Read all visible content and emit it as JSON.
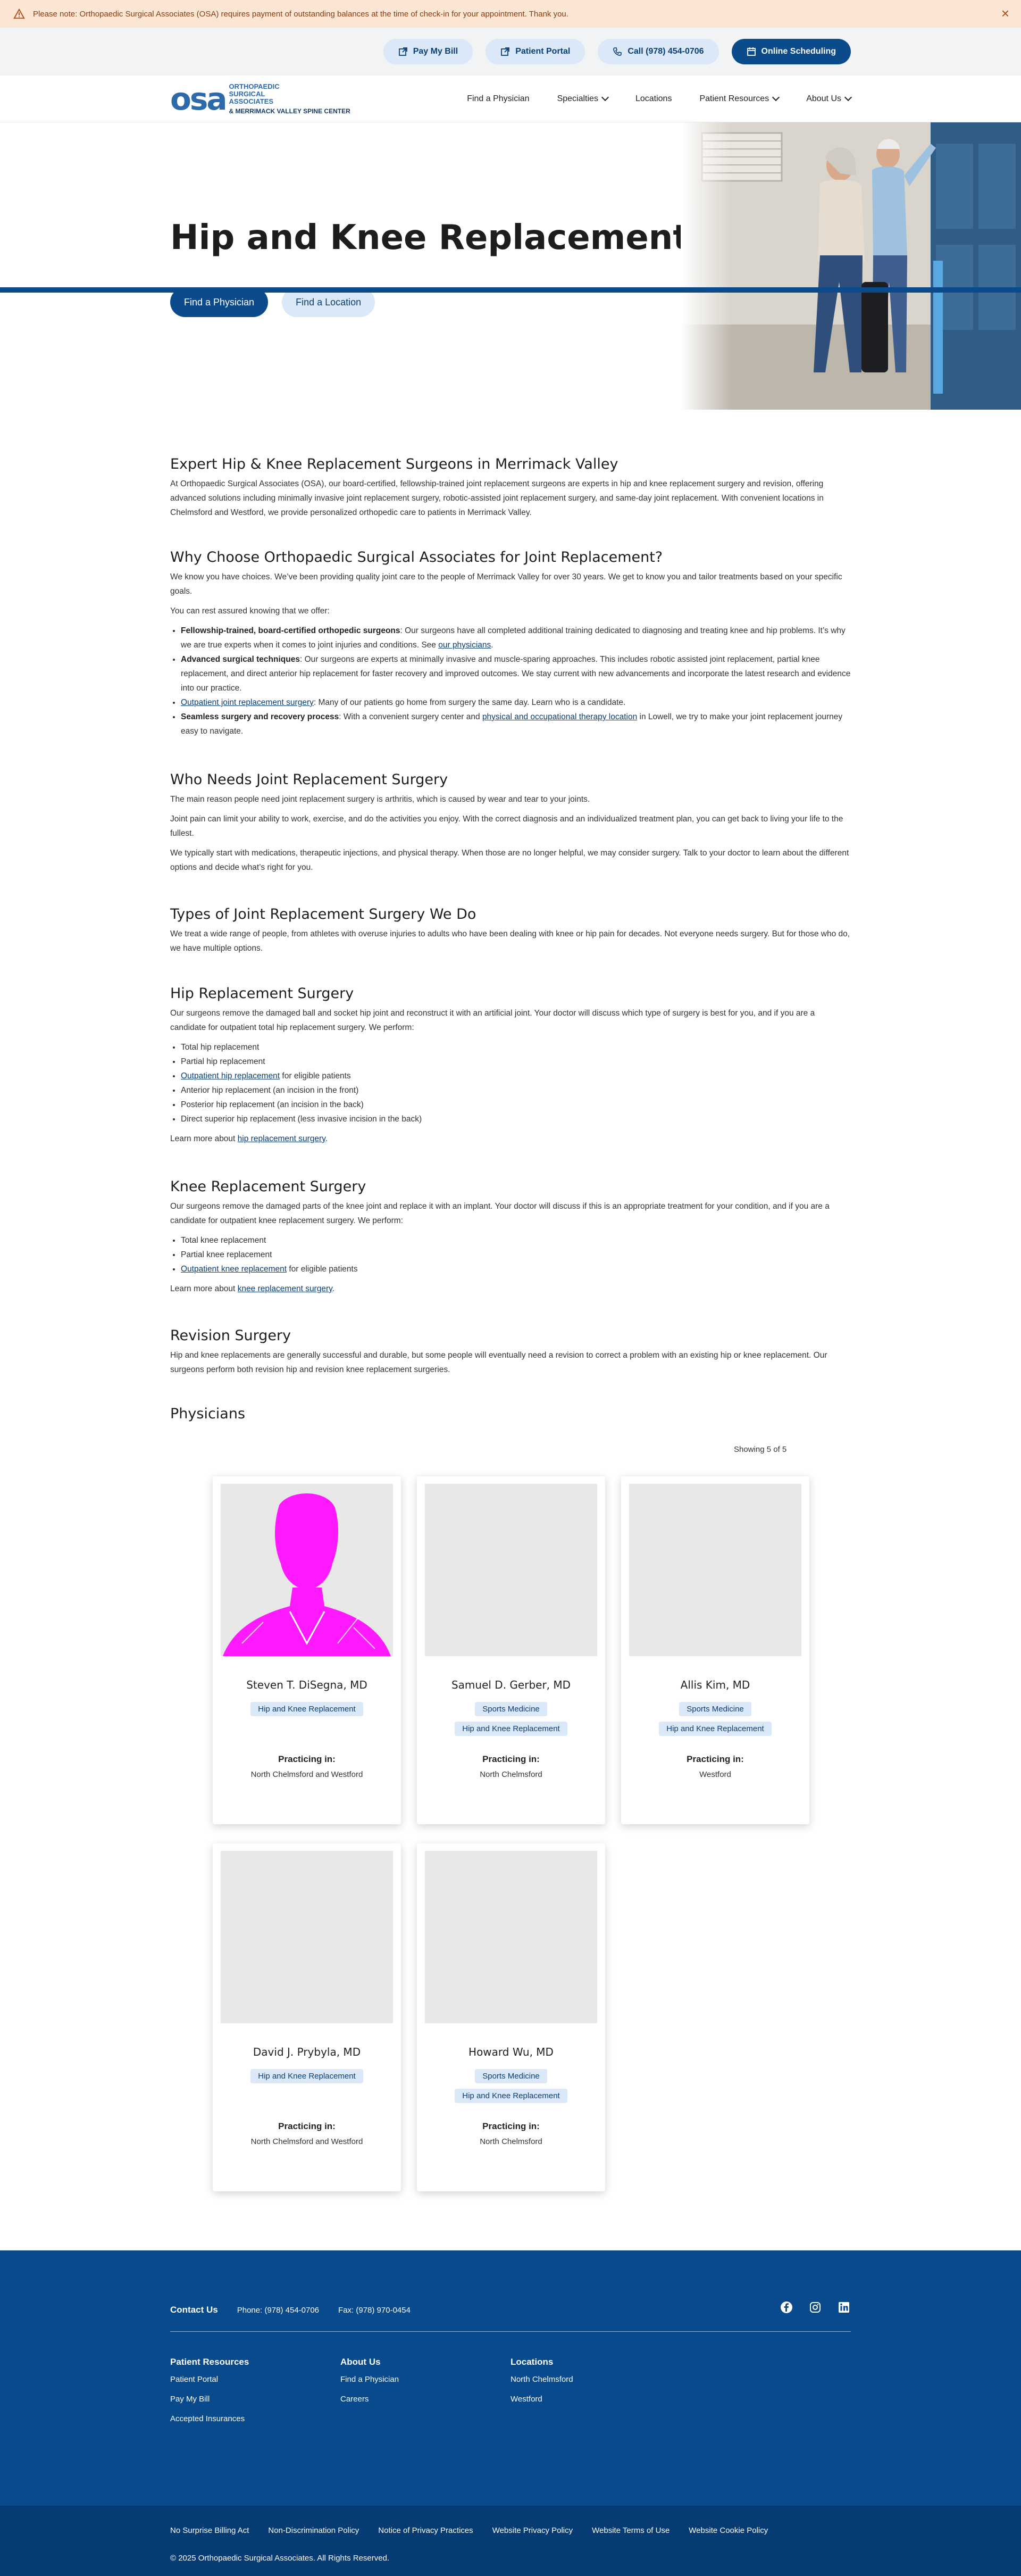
{
  "alert": {
    "text": "Please note: Orthopaedic Surgical Associates (OSA) requires payment of outstanding balances at the time of check-in for your appointment. Thank you.",
    "icon": "warning-icon",
    "close_icon": "close-icon"
  },
  "utility": {
    "pay_bill": "Pay My Bill",
    "patient_portal": "Patient Portal",
    "call": "Call (978) 454-0706",
    "online_scheduling": "Online Scheduling"
  },
  "logo": {
    "mark": "osa",
    "line1": "ORTHOPAEDIC",
    "line2": "SURGICAL",
    "line3": "ASSOCIATES",
    "line4": "& MERRIMACK VALLEY SPINE CENTER"
  },
  "nav": {
    "find_physician": "Find a Physician",
    "specialties": "Specialties",
    "locations": "Locations",
    "patient_resources": "Patient Resources",
    "about_us": "About Us"
  },
  "hero": {
    "title": "Hip and Knee Replacement",
    "btn_physician": "Find a Physician",
    "btn_location": "Find a Location"
  },
  "s1": {
    "heading": "Expert Hip & Knee Replacement Surgeons in Merrimack Valley",
    "p1": "At Orthopaedic Surgical Associates (OSA), our board-certified, fellowship-trained joint replacement surgeons are experts in hip and knee replacement surgery and revision, offering advanced solutions including minimally invasive joint replacement surgery, robotic-assisted joint replacement surgery, and same-day joint replacement. With convenient locations in Chelmsford and Westford, we provide personalized orthopedic care to patients in Merrimack Valley."
  },
  "s2": {
    "heading": "Why Choose Orthopaedic Surgical Associates for Joint Replacement?",
    "p1": "We know you have choices. We’ve been providing quality joint care to the people of Merrimack Valley for over 30 years. We get to know you and tailor treatments based on your specific goals.",
    "p2": "You can rest assured knowing that we offer:",
    "b1_bold": "Fellowship-trained, board-certified orthopedic surgeons",
    "b1_text": ": Our surgeons have all completed additional training dedicated to diagnosing and treating knee and hip problems. It’s why we are true experts when it comes to joint injuries and conditions. See ",
    "b1_link": "our physicians",
    "b1_end": ".",
    "b2_bold": "Advanced surgical techniques",
    "b2_text": ": Our surgeons are experts at minimally invasive and muscle-sparing approaches. This includes robotic assisted joint replacement, partial knee replacement, and direct anterior hip replacement for faster recovery and improved outcomes. We stay current with new advancements and incorporate the latest research and evidence into our practice.",
    "b3_link": "Outpatient joint replacement surgery",
    "b3_text": ": Many of our patients go home from surgery the same day. Learn who is a candidate.",
    "b4_bold": "Seamless surgery and recovery process",
    "b4_text": ": With a convenient surgery center and ",
    "b4_link": "physical and occupational therapy location",
    "b4_end": " in Lowell, we try to make your joint replacement journey easy to navigate."
  },
  "s3": {
    "heading": "Who Needs Joint Replacement Surgery",
    "p1": "The main reason people need joint replacement surgery is arthritis, which is caused by wear and tear to your joints.",
    "p2": "Joint pain can limit your ability to work, exercise, and do the activities you enjoy. With the correct diagnosis and an individualized treatment plan, you can get back to living your life to the fullest.",
    "p3": "We typically start with medications, therapeutic injections, and physical therapy. When those are no longer helpful, we may consider surgery. Talk to your doctor to learn about the different options and decide what’s right for you."
  },
  "s4": {
    "heading": "Types of Joint Replacement Surgery We Do",
    "p1": "We treat a wide range of people, from athletes with overuse injuries to adults who have been dealing with knee or hip pain for decades. Not everyone needs surgery. But for those who do, we have multiple options."
  },
  "s5": {
    "heading": "Hip Replacement Surgery",
    "p1": "Our surgeons remove the damaged ball and socket hip joint and reconstruct it with an artificial joint. Your doctor will discuss which type of surgery is best for you, and if you are a candidate for outpatient total hip replacement surgery. We perform:",
    "li1": "Total hip replacement",
    "li2": "Partial hip replacement",
    "li3_link": "Outpatient hip replacement",
    "li3_text": " for eligible patients",
    "li4": "Anterior hip replacement (an incision in the front)",
    "li5": "Posterior hip replacement (an incision in the back)",
    "li6": "Direct superior hip replacement (less invasive incision in the back)",
    "more_text": "Learn more about ",
    "more_link": "hip replacement surgery",
    "more_end": "."
  },
  "s6": {
    "heading": "Knee Replacement Surgery",
    "p1": "Our surgeons remove the damaged parts of the knee joint and replace it with an implant. Your doctor will discuss if this is an appropriate treatment for your condition, and if you are a candidate for outpatient knee replacement surgery. We perform:",
    "li1": "Total knee replacement",
    "li2": "Partial knee replacement",
    "li3_link": "Outpatient knee replacement",
    "li3_text": " for eligible patients",
    "more_text": "Learn more about ",
    "more_link": "knee replacement surgery",
    "more_end": "."
  },
  "s7": {
    "heading": "Revision Surgery",
    "p1": "Hip and knee replacements are generally successful and durable, but some people will eventually need a revision to correct a problem with an existing hip or knee replacement. Our surgeons perform both revision hip and revision knee replacement surgeries."
  },
  "physicians": {
    "heading": "Physicians",
    "showing": "Showing 5 of 5",
    "practicing_label": "Practicing in:",
    "cards": [
      {
        "name": "Steven T. DiSegna, MD",
        "tags": [
          "Hip and Knee Replacement"
        ],
        "location": "North Chelmsford and Westford"
      },
      {
        "name": "Samuel D. Gerber, MD",
        "tags": [
          "Sports Medicine",
          "Hip and Knee Replacement"
        ],
        "location": "North Chelmsford"
      },
      {
        "name": "Allis Kim, MD",
        "tags": [
          "Sports Medicine",
          "Hip and Knee Replacement"
        ],
        "location": "Westford"
      },
      {
        "name": "David J. Prybyla, MD",
        "tags": [
          "Hip and Knee Replacement"
        ],
        "location": "North Chelmsford and Westford"
      },
      {
        "name": "Howard Wu, MD",
        "tags": [
          "Sports Medicine",
          "Hip and Knee Replacement"
        ],
        "location": "North Chelmsford"
      }
    ]
  },
  "footer": {
    "contact_label": "Contact Us",
    "phone": "Phone: (978) 454-0706",
    "fax": "Fax: (978) 970-0454",
    "col1_title": "Patient Resources",
    "col1_items": [
      "Patient Portal",
      "Pay My Bill",
      "Accepted Insurances"
    ],
    "col2_title": "About Us",
    "col2_items": [
      "Find a Physician",
      "Careers"
    ],
    "col3_title": "Locations",
    "col3_items": [
      "North Chelmsford",
      "Westford"
    ],
    "legal_links": [
      "No Surprise Billing Act",
      "Non-Discrimination Policy",
      "Notice of Privacy Practices",
      "Website Privacy Policy",
      "Website Terms of Use",
      "Website Cookie Policy"
    ],
    "copyright": "© 2025 Orthopaedic Surgical Associates. All Rights Reserved."
  },
  "colors": {
    "brand_dark": "#0b4a8b",
    "brand_light": "#dbe8f7",
    "alert_bg": "#fbe6d4",
    "footer_bg": "#084a8c"
  }
}
